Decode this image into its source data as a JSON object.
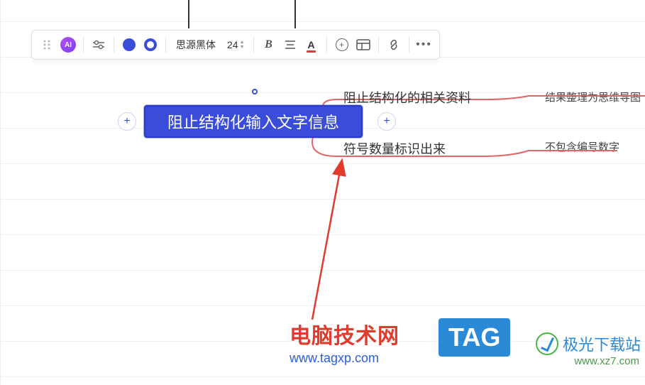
{
  "toolbar": {
    "ai_label": "AI",
    "font_name": "思源黑体",
    "font_size": "24",
    "fill_color": "#3a4dd8",
    "stroke_color": "#3a4dd8"
  },
  "node": {
    "selected_text": "阻止结构化输入文字信息"
  },
  "children": [
    {
      "text": "阻止结构化的相关资料"
    },
    {
      "text": "符号数量标识出来"
    }
  ],
  "far_nodes": [
    {
      "text": "结果整理为思维导图"
    },
    {
      "text": "不包含编号数字"
    }
  ],
  "watermark1": {
    "title": "电脑技术网",
    "url": "www.tagxp.com"
  },
  "tag_label": "TAG",
  "watermark2": {
    "text": "极光下载站",
    "url": "www.xz7.com"
  }
}
